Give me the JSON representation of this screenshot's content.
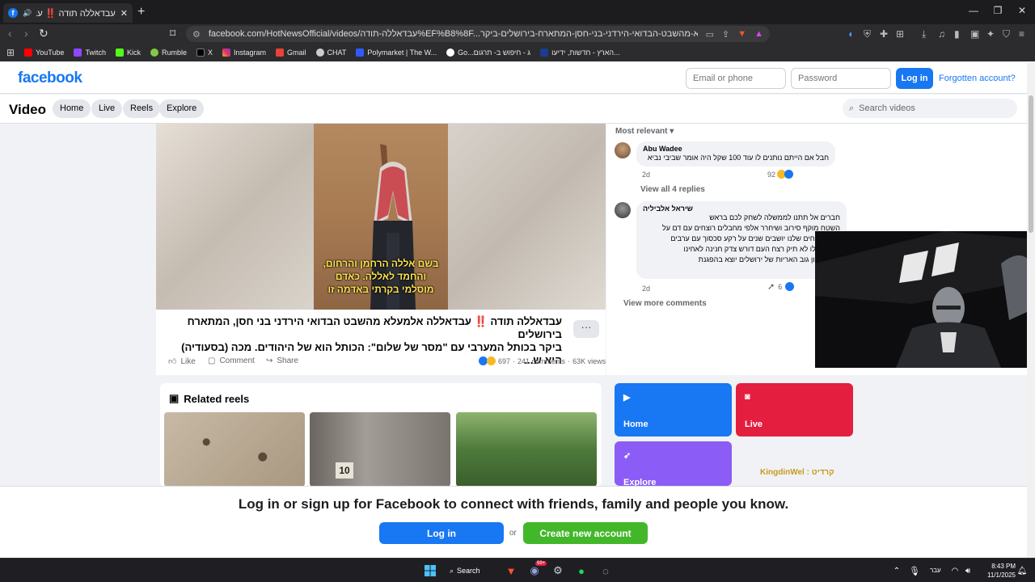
{
  "browser": {
    "tab_title": "עבדאללה תודה ‼️ עבדאללה אל...",
    "url": "facebook.com/HotNewsOfficial/videos/עבדאללה-תודה%EF%B8%8F...עבדאללה-אלמעלא-מהשבט-הבדואי-הירדני-בני-חסן-המתארח-בירושלים-ביקר-",
    "bookmarks": [
      "YouTube",
      "Twitch",
      "Kick",
      "Rumble",
      "X",
      "Instagram",
      "Gmail",
      "CHAT",
      "Polymarket | The W...",
      "Go...ג - חיפוש ב- תרגום",
      "הארץ - חדשות, ידיעו..."
    ]
  },
  "header": {
    "logo": "facebook",
    "email_placeholder": "Email or phone",
    "password_placeholder": "Password",
    "login_label": "Log in",
    "forgot_label": "Forgotten account?"
  },
  "videobar": {
    "title": "Video",
    "tabs": [
      "Home",
      "Live",
      "Reels",
      "Explore"
    ],
    "search_placeholder": "Search videos"
  },
  "video": {
    "subtitles": [
      "בשם אללה הרחמן והרחום,",
      "והחמד לאללה. כאדם",
      "מוסלמי בקרתי באדמה זו"
    ],
    "title_line1": "עבדאללה תודה ‼️ עבדאללה אלמעלא מהשבט הבדואי הירדני בני חסן, המתארח בירושלים",
    "title_line2": "ביקר בכותל המערבי עם \"מסר של שלום\": הכותל הוא של היהודים. מכה (בסעודיה) היא ש...",
    "more_label": "···",
    "actions": {
      "like": "Like",
      "comment": "Comment",
      "share": "Share"
    },
    "reaction_count": "697",
    "comments_count": "241 comments",
    "views": "63K views"
  },
  "comments": {
    "sort_label": "Most relevant",
    "items": [
      {
        "name": "Abu Wadee",
        "text": "חבל אם הייתם נותנים לו עוד 100 שקל היה אומר שביבי נביא",
        "time": "2d",
        "reactions": "92"
      },
      {
        "name": "שיראל אלביליה",
        "text_lines": [
          "חברים אל תתנו לממשלה לשחק לכם בראש",
          "השטח מוקף סירוב ושיחרר אלפי מחבלים רוצחים עם דם על",
          "בזמן שאחים שלנו יושבים שנים על רקע סכסוך עם ערבים",
          "הזה אפילו לא תיק רצח העם דורש צדק חנינה לאחינו",
          "בצל ארגון גוב האריות של ירושלים יוצא בהפגנת"
        ],
        "see_more": "Se",
        "time": "2d",
        "reactions": "6"
      }
    ],
    "view_replies": "View all 4 replies",
    "view_more": "View more comments"
  },
  "related": {
    "title": "Related reels",
    "reel2_number": "10",
    "tiles": [
      {
        "label": "Home",
        "color": "#1877f2"
      },
      {
        "label": "Live",
        "color": "#e41e3f"
      },
      {
        "label": "Explore",
        "color": "#8b5cf6"
      }
    ],
    "watermark": "KingdinWel : קרדיט"
  },
  "banner": {
    "text": "Log in or sign up for Facebook to connect with friends, family and people you know.",
    "login_label": "Log in",
    "or": "or",
    "create_label": "Create new account"
  },
  "taskbar": {
    "search_label": "Search",
    "lang": "עבר",
    "time": "8:43 PM",
    "date": "11/1/2025",
    "notif_count": "99+"
  }
}
